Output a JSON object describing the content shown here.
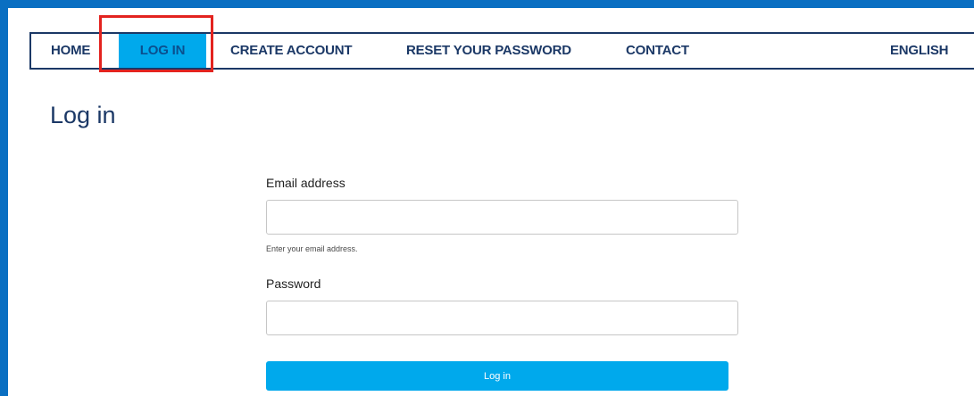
{
  "nav": {
    "home": "HOME",
    "login": "LOG IN",
    "create_account": "CREATE ACCOUNT",
    "reset_password": "RESET YOUR PASSWORD",
    "contact": "CONTACT",
    "language": "ENGLISH"
  },
  "page": {
    "title": "Log in"
  },
  "form": {
    "email_label": "Email address",
    "email_value": "",
    "email_help": "Enter your email address.",
    "password_label": "Password",
    "password_value": "",
    "submit_label": "Log in"
  },
  "colors": {
    "frame_blue": "#0a6fc2",
    "nav_text": "#1b3866",
    "accent": "#00a9ec",
    "highlight": "#e3231f"
  }
}
